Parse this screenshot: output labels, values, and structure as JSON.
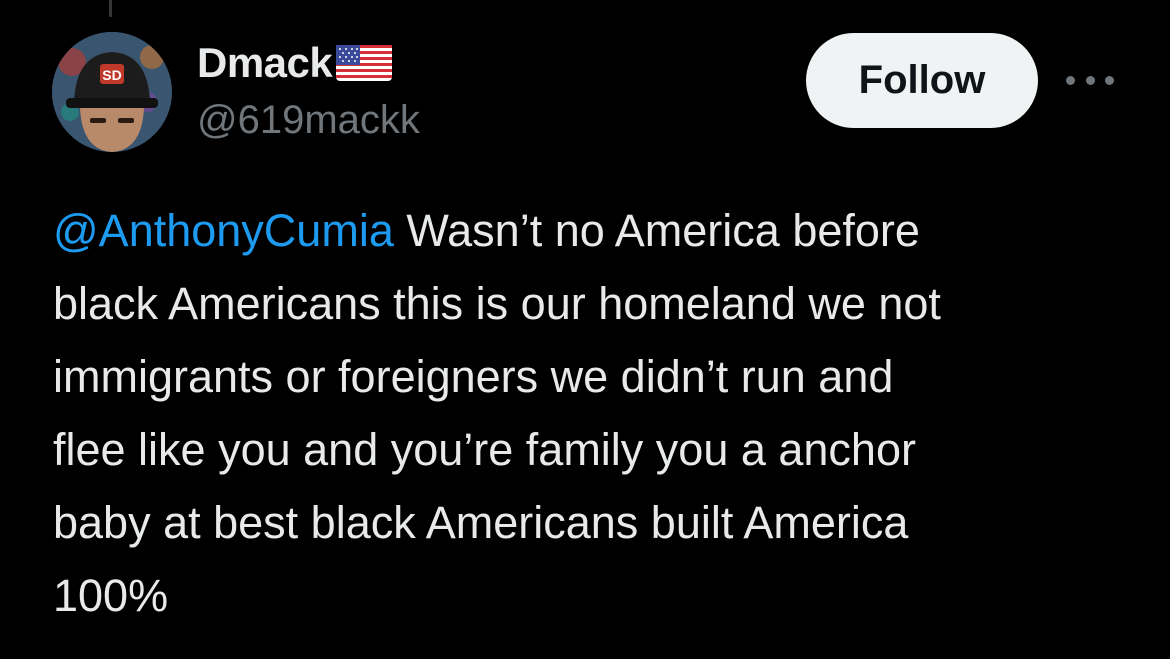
{
  "author": {
    "display_name": "Dmack",
    "handle": "@619mackk",
    "badge_icon": "us-flag-icon",
    "avatar_icon": "profile-avatar"
  },
  "actions": {
    "follow_label": "Follow",
    "more_icon": "more-options-icon"
  },
  "tweet": {
    "mention": "@AnthonyCumia",
    "line1_rest": " Wasn’t no America before",
    "line2": "black Americans this is our homeland we not",
    "line3": "immigrants or foreigners we didn’t run and",
    "line4": "flee like you and you’re family you a anchor",
    "line5": "baby at best black Americans built America",
    "line6": "100%"
  },
  "colors": {
    "background": "#000000",
    "text": "#e7e9ea",
    "secondary_text": "#71767b",
    "mention": "#1d9bf0",
    "follow_button_bg": "#eff3f4",
    "follow_button_text": "#0f1419"
  }
}
